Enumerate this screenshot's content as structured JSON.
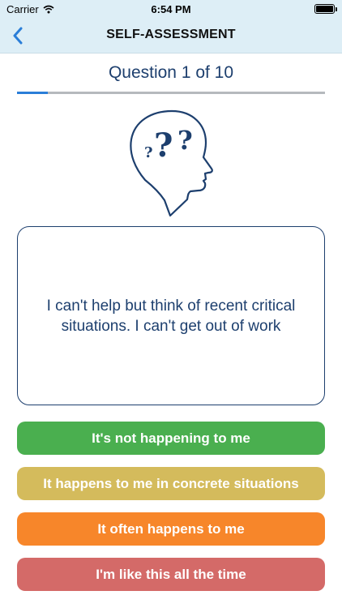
{
  "status_bar": {
    "carrier": "Carrier",
    "time": "6:54 PM",
    "wifi_icon": "wifi-icon",
    "battery_icon": "battery-icon"
  },
  "nav": {
    "title": "SELF-ASSESSMENT",
    "back_icon": "chevron-left-icon"
  },
  "quiz": {
    "counter": "Question 1 of 10",
    "progress_fraction": 0.1,
    "illustration": "head-question-marks-icon",
    "question": "I can't help but think of recent critical situations. I can't get out of work"
  },
  "answers": [
    {
      "label": "It's not happening to me",
      "color": "#4aaf4f"
    },
    {
      "label": "It happens to me in concrete situations",
      "color": "#d4bb5c"
    },
    {
      "label": "It often happens to me",
      "color": "#f7862a"
    },
    {
      "label": "I'm like this all the time",
      "color": "#d46a68"
    }
  ],
  "colors": {
    "header_bg": "#ddeef6",
    "accent_blue": "#2a7ed8",
    "text_navy": "#1d3f6e"
  }
}
